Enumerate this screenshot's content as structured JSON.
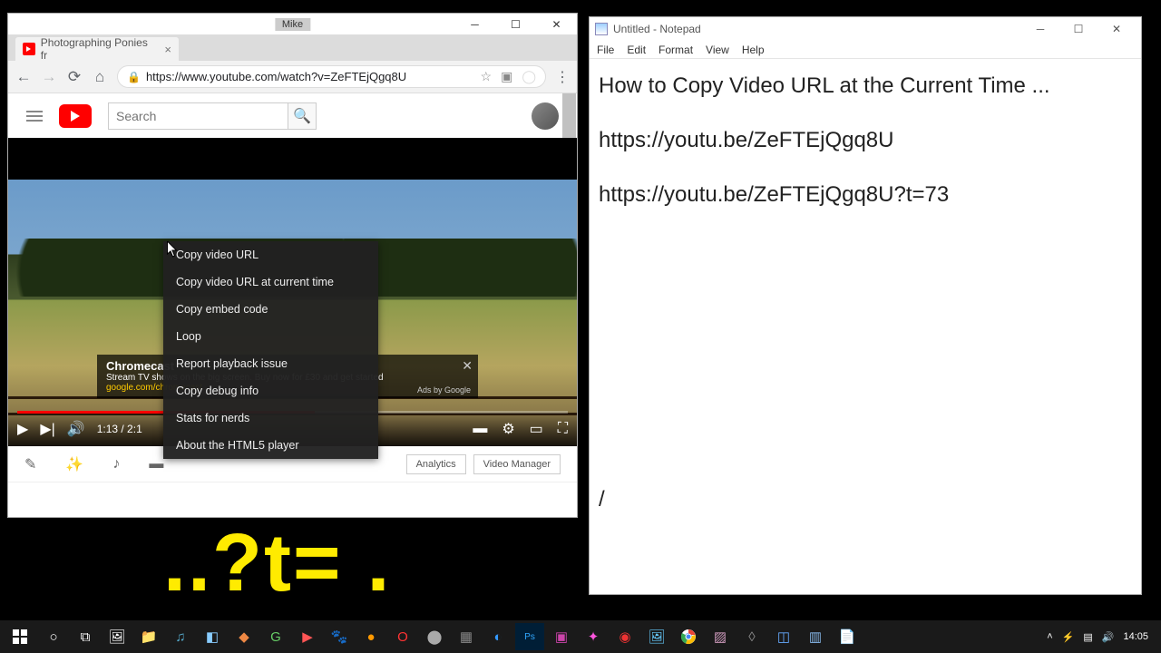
{
  "chrome": {
    "titlebar_label": "Mike",
    "tab": {
      "title": "Photographing Ponies fr"
    },
    "url": "https://www.youtube.com/watch?v=ZeFTEjQgq8U",
    "search_placeholder": "Search"
  },
  "ad": {
    "title": "Chromecast",
    "line1": "Stream TV shows on the big screen. Buy now for £30 and get started",
    "line2": "google.com/chromecast",
    "by": "Ads by Google"
  },
  "player": {
    "time": "1:13 / 2:1"
  },
  "context_menu": [
    "Copy video URL",
    "Copy video URL at current time",
    "Copy embed code",
    "Loop",
    "Report playback issue",
    "Copy debug info",
    "Stats for nerds",
    "About the HTML5 player"
  ],
  "under_video": {
    "analytics": "Analytics",
    "video_manager": "Video Manager"
  },
  "notepad": {
    "title": "Untitled - Notepad",
    "menu": [
      "File",
      "Edit",
      "Format",
      "View",
      "Help"
    ],
    "line1": "How to Copy Video URL at the Current Time ...",
    "line2": "https://youtu.be/ZeFTEjQgq8U",
    "line3": "https://youtu.be/ZeFTEjQgq8U?t=73",
    "line4": "/"
  },
  "overlay_text": "..?t= .",
  "taskbar": {
    "time": "14:05"
  }
}
